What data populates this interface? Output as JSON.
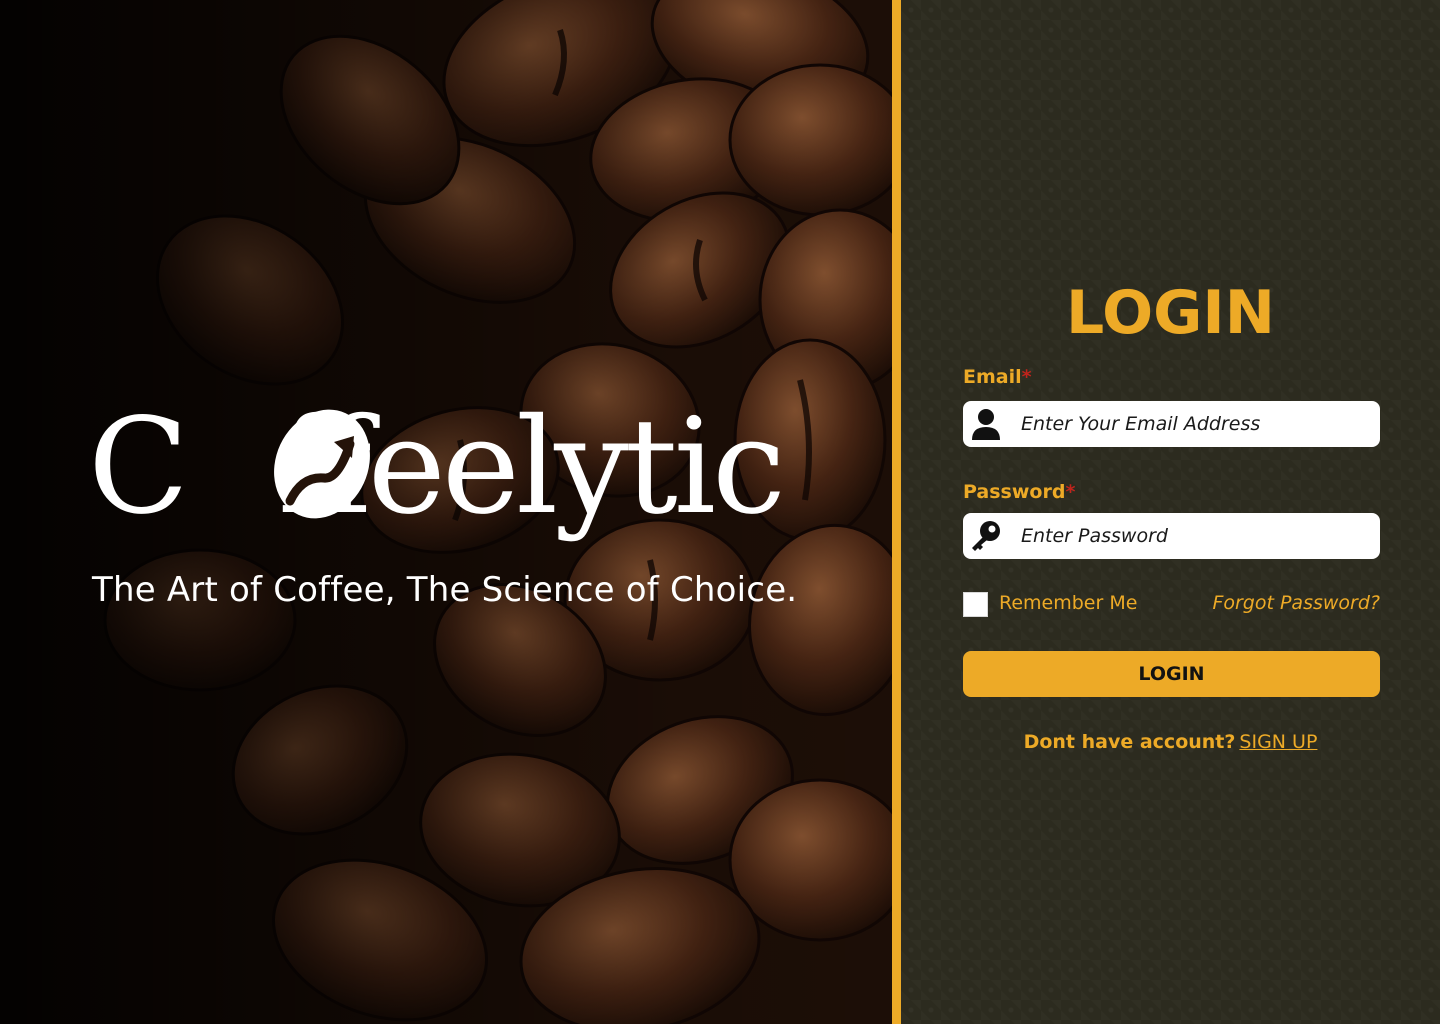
{
  "brand": {
    "logo_lead": "C",
    "logo_rest": "ffeelytic",
    "tagline": "The Art of Coffee, The Science of Choice."
  },
  "login": {
    "title": "LOGIN",
    "email_label": "Email",
    "email_placeholder": "Enter Your Email Address",
    "password_label": "Password",
    "password_placeholder": "Enter Password",
    "required_mark": "*",
    "remember_label": "Remember Me",
    "forgot_label": "Forgot Password?",
    "submit_label": "LOGIN",
    "signup_prompt": "Dont have account?",
    "signup_link": "SIGN UP"
  },
  "colors": {
    "accent": "#edaa27",
    "panel_bg": "#2c2b1f",
    "required": "#c0241c",
    "field_bg": "#ffffff"
  },
  "icons": {
    "email": "user-icon",
    "password": "key-icon",
    "logo": "coffee-bean-growth-icon"
  }
}
